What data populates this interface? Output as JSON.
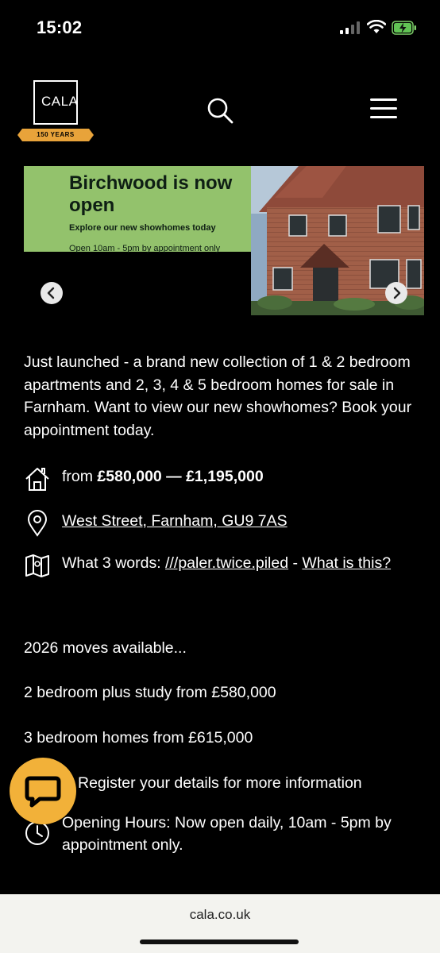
{
  "status_bar": {
    "time": "15:02"
  },
  "header": {
    "logo_text": "CALA",
    "logo_ribbon": "150 YEARS",
    "search_icon": "search-icon",
    "menu_icon": "hamburger-menu-icon"
  },
  "banner": {
    "title": "Birchwood is now open",
    "subtitle": "Explore our new showhomes today",
    "hours": "Open 10am - 5pm by appointment only",
    "green_color": "#93c26c",
    "prev_icon": "chevron-left-icon",
    "next_icon": "chevron-right-icon"
  },
  "description": "Just launched - a brand new collection of 1 & 2 bedroom apartments and 2, 3, 4 & 5 bedroom homes for sale in Farnham. Want to view our new showhomes? Book your appointment today.",
  "price": {
    "prefix": "from",
    "range": "£580,000 — £1,195,000",
    "icon": "house-icon"
  },
  "address": {
    "text": "West Street, Farnham, GU9 7AS",
    "icon": "map-pin-icon"
  },
  "what3words": {
    "label": "What 3 words:",
    "words": "///paler.twice.piled",
    "separator": " - ",
    "help_link": "What is this?",
    "icon": "map-icon"
  },
  "moves_available": "2026 moves available...",
  "two_bed": "2 bedroom plus study from £580,000",
  "three_bed": "3 bedroom homes from £615,000",
  "register": "Register your details for more information",
  "opening_hours": {
    "text": "Opening Hours: Now open daily, 10am - 5pm by appointment only.",
    "icon": "clock-icon"
  },
  "chat": {
    "icon": "chat-bubble-icon",
    "color": "#f2b139"
  },
  "url_bar": {
    "url": "cala.co.uk"
  }
}
